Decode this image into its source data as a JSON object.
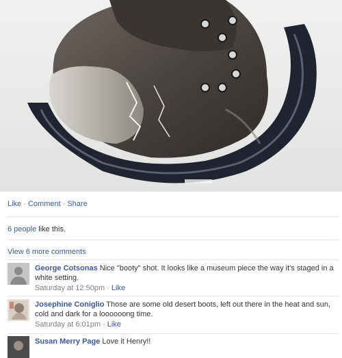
{
  "photo": {
    "icon": "boot-photo",
    "background": "#ecedec"
  },
  "actions": {
    "like": "Like",
    "sep1": " · ",
    "comment": "Comment",
    "sep2": " · ",
    "share": "Share"
  },
  "likes": {
    "count_text": "6 people",
    "suffix": " like this."
  },
  "view_more": "View 6 more comments",
  "comments": [
    {
      "author": "George Cotsonas",
      "text": " Nice \"booty\" shot. It looks like a museum piece the way it's staged in a white setting.",
      "time": "Saturday at 12:50pm",
      "sep": " · ",
      "like": "Like"
    },
    {
      "author": "Josephine Coniglio",
      "text": " Those are some old desert boots, left out there in the heat and sun, cold and dark for a loooooong time.",
      "time": "Saturday at 6:01pm",
      "sep": " · ",
      "like": "Like"
    },
    {
      "author": "Susan Merry Page",
      "text": " Love it Henry!!"
    }
  ],
  "colors": {
    "link": "#3b5998",
    "text": "#333333",
    "meta": "#808080",
    "divider": "#e3e6ee"
  }
}
